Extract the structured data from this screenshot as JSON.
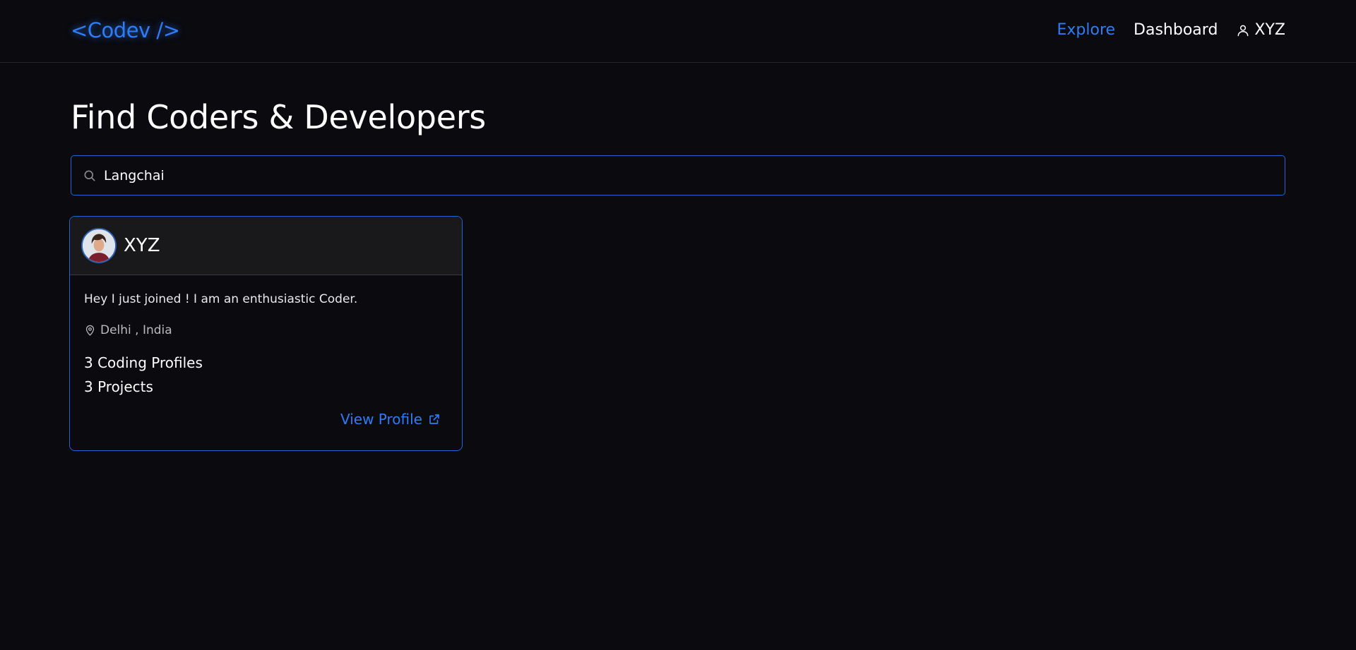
{
  "colors": {
    "accent": "#2f7cf6",
    "background": "#0a0a0f",
    "card_header": "#19191c",
    "border": "#2a5fd8"
  },
  "navbar": {
    "logo": "<Codev />",
    "links": [
      {
        "label": "Explore",
        "active": true
      },
      {
        "label": "Dashboard",
        "active": false
      }
    ],
    "user": {
      "icon": "user-icon",
      "name": "XYZ"
    }
  },
  "main": {
    "title": "Find Coders & Developers",
    "search": {
      "icon": "search-icon",
      "value": "Langchai",
      "placeholder": ""
    }
  },
  "results": [
    {
      "name": "XYZ",
      "avatar": "avatar-photo",
      "bio": "Hey I just joined ! I am an enthusiastic Coder.",
      "location_icon": "map-pin-icon",
      "location": "Delhi , India",
      "coding_profiles": "3 Coding Profiles",
      "projects": "3 Projects",
      "view_profile_label": "View Profile",
      "view_profile_icon": "external-link-icon"
    }
  ]
}
